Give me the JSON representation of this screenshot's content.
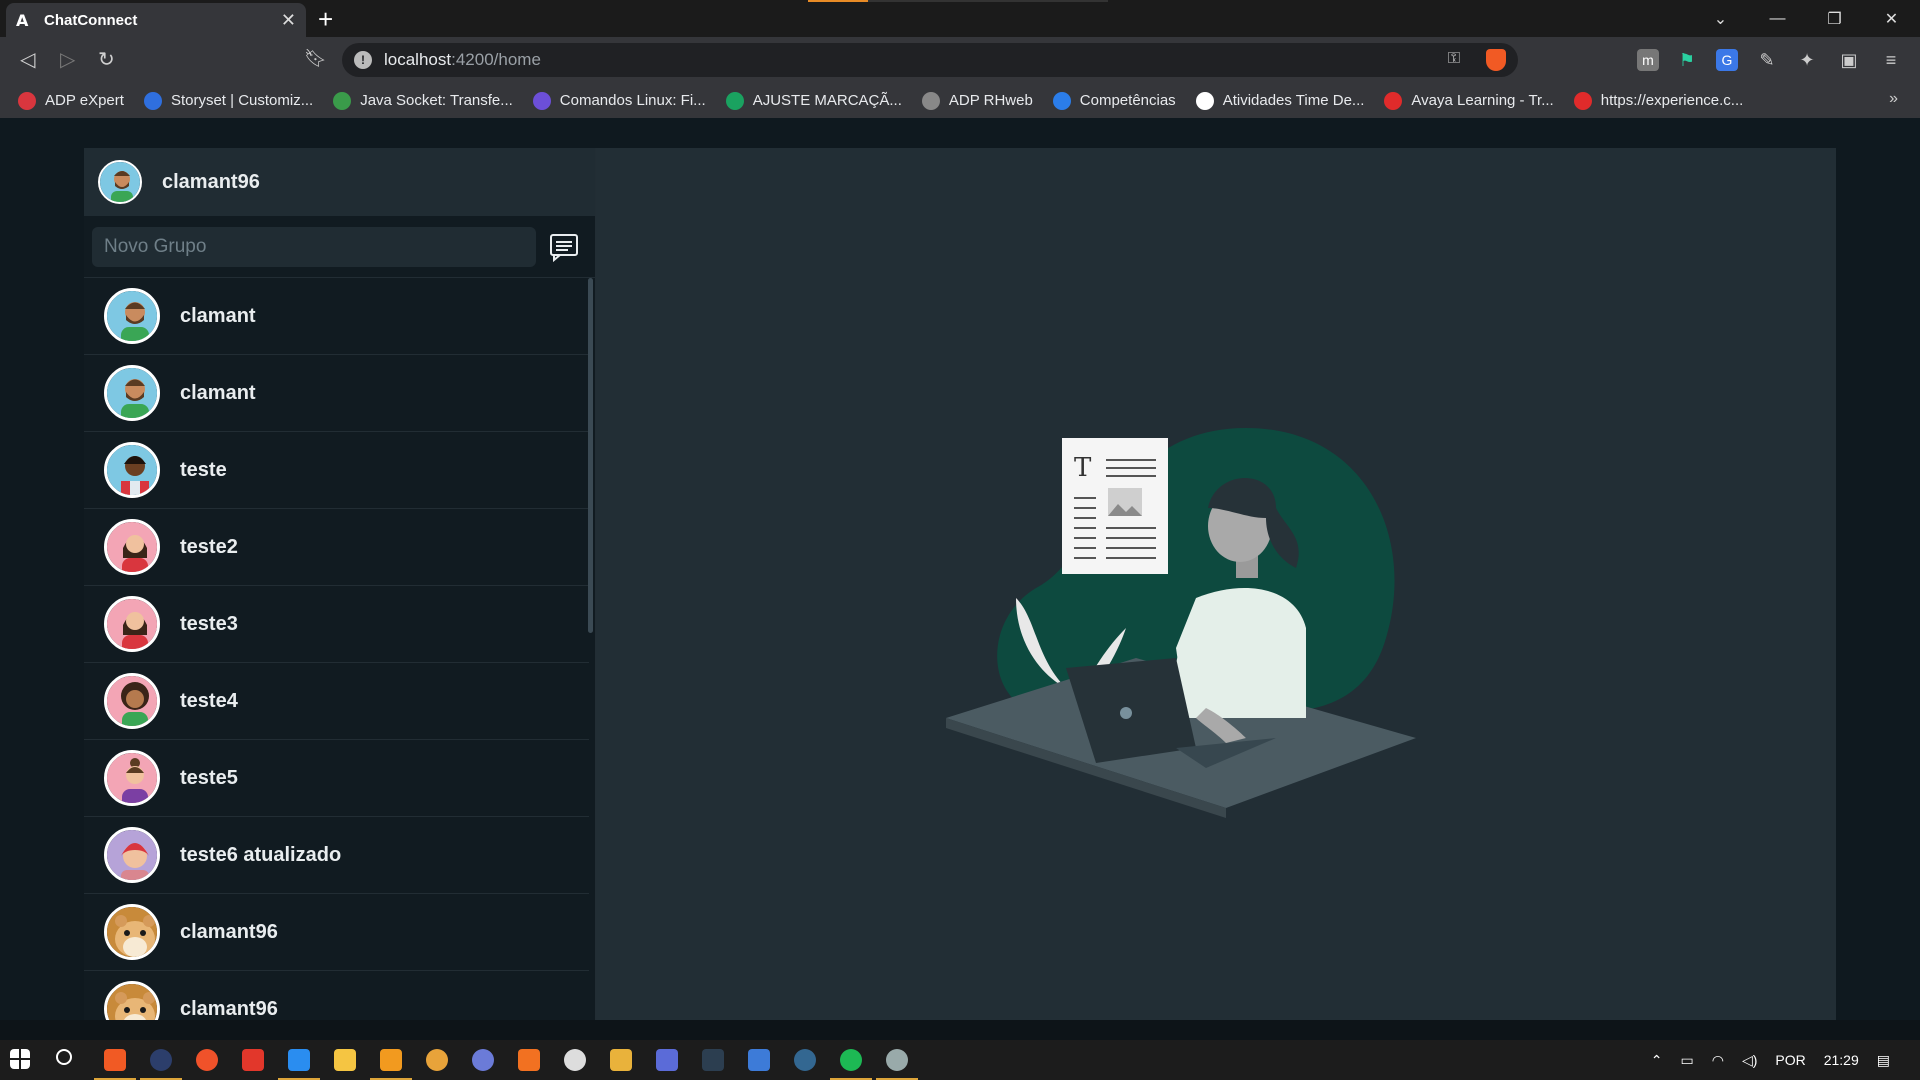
{
  "browser": {
    "tab_title": "ChatConnect",
    "tab_favicon": "A",
    "url_host": "localhost",
    "url_path": ":4200/home",
    "bookmarks": [
      {
        "label": "ADP eXpert",
        "color": "#d9363e"
      },
      {
        "label": "Storyset | Customiz...",
        "color": "#2f6fde"
      },
      {
        "label": "Java Socket: Transfe...",
        "color": "#3a9b4a"
      },
      {
        "label": "Comandos Linux: Fi...",
        "color": "#6c4fd8"
      },
      {
        "label": "AJUSTE MARCAÇÃ...",
        "color": "#1aa260"
      },
      {
        "label": "ADP RHweb",
        "color": "#888888"
      },
      {
        "label": "Competências",
        "color": "#2b7de9"
      },
      {
        "label": "Atividades Time De...",
        "color": "#ffffff"
      },
      {
        "label": "Avaya Learning - Tr...",
        "color": "#e02b2b"
      },
      {
        "label": "https://experience.c...",
        "color": "#e02b2b"
      }
    ]
  },
  "sidebar": {
    "current_user": "clamant96",
    "search_placeholder": "Novo Grupo",
    "chats": [
      {
        "name": "clamant",
        "avatar": "man-beard-green"
      },
      {
        "name": "clamant",
        "avatar": "man-beard-green"
      },
      {
        "name": "teste",
        "avatar": "man-dark-red"
      },
      {
        "name": "teste2",
        "avatar": "woman-red-dress"
      },
      {
        "name": "teste3",
        "avatar": "woman-red-dress"
      },
      {
        "name": "teste4",
        "avatar": "woman-curly-green"
      },
      {
        "name": "teste5",
        "avatar": "woman-bun-purple"
      },
      {
        "name": "teste6 atualizado",
        "avatar": "illustrated-red-hair"
      },
      {
        "name": "clamant96",
        "avatar": "hamster-photo"
      },
      {
        "name": "clamant96",
        "avatar": "hamster-photo"
      }
    ]
  },
  "taskbar": {
    "language": "POR",
    "time": "21:29"
  },
  "colors": {
    "sidebar_bg": "#111b21",
    "header_bg": "#202c33",
    "main_bg": "#222e35",
    "accent_green": "#0d4a3f"
  }
}
